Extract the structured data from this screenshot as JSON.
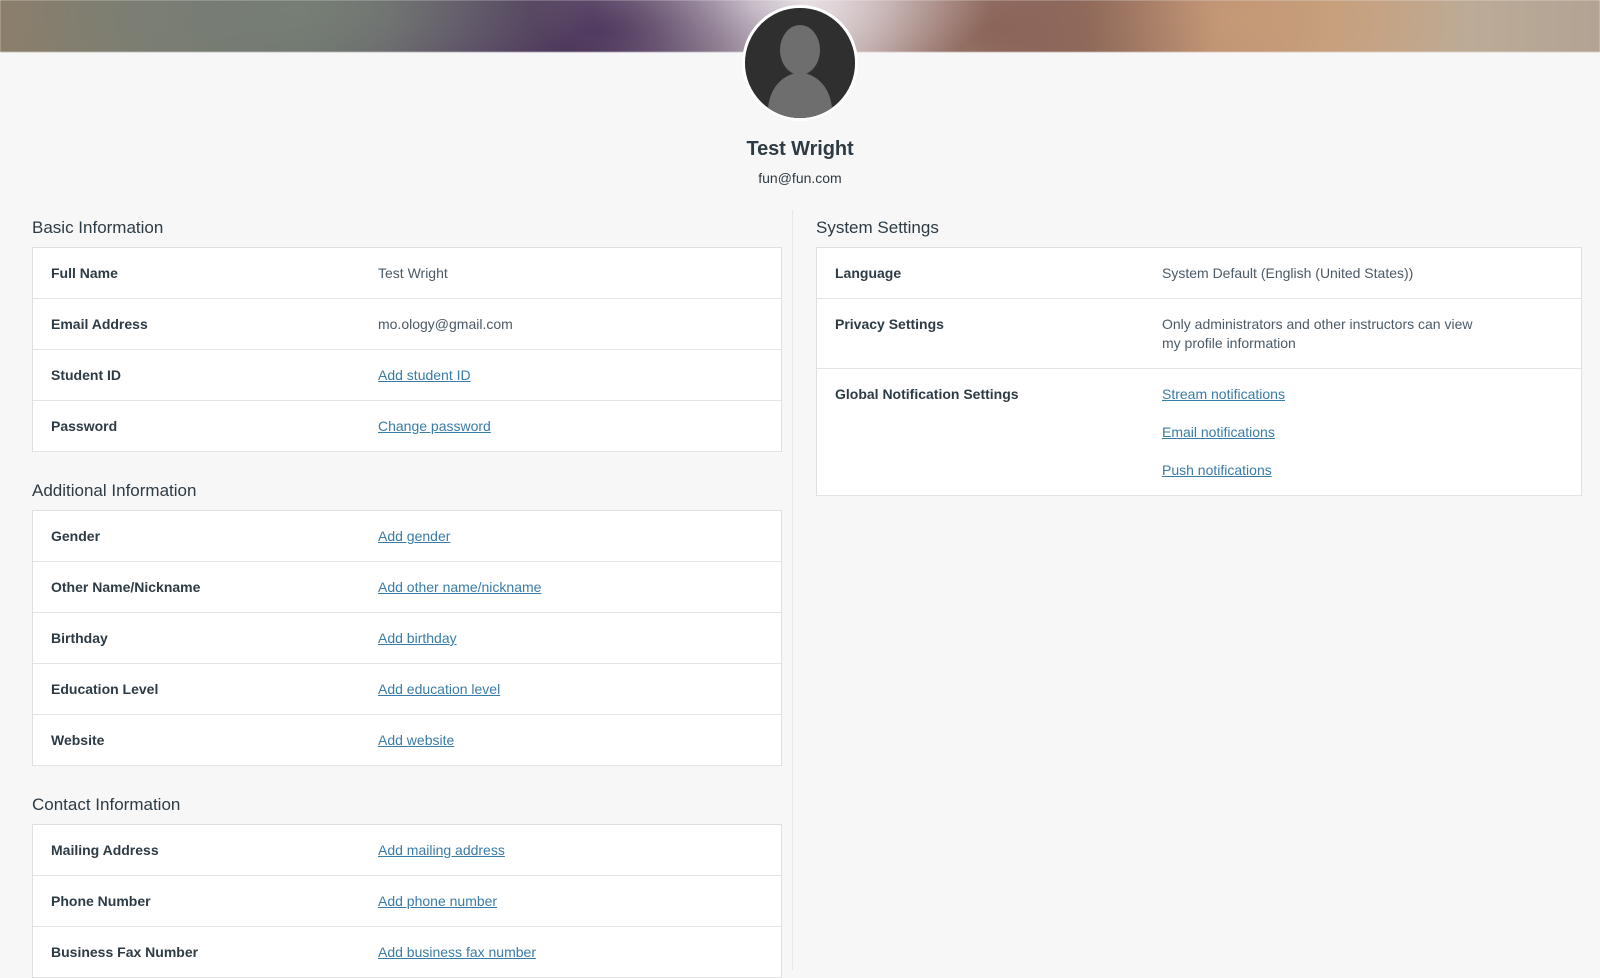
{
  "profile": {
    "name": "Test Wright",
    "email": "fun@fun.com",
    "avatar_icon": "user-silhouette-avatar"
  },
  "colors": {
    "link": "#3a7ca5",
    "text": "#2d3b45",
    "page_background": "#f7f7f7",
    "table_border": "#dfdfdf"
  },
  "left_column": {
    "sections": [
      {
        "title": "Basic Information",
        "rows": [
          {
            "label": "Full Name",
            "value": "Test Wright",
            "is_link": false
          },
          {
            "label": "Email Address",
            "value": "mo.ology@gmail.com",
            "is_link": false
          },
          {
            "label": "Student ID",
            "value": "Add student ID",
            "is_link": true
          },
          {
            "label": "Password",
            "value": "Change password",
            "is_link": true
          }
        ]
      },
      {
        "title": "Additional Information",
        "rows": [
          {
            "label": "Gender",
            "value": "Add gender",
            "is_link": true
          },
          {
            "label": "Other Name/Nickname",
            "value": "Add other name/nickname",
            "is_link": true
          },
          {
            "label": "Birthday",
            "value": "Add birthday",
            "is_link": true
          },
          {
            "label": "Education Level",
            "value": "Add education level",
            "is_link": true
          },
          {
            "label": "Website",
            "value": "Add website",
            "is_link": true
          }
        ]
      },
      {
        "title": "Contact Information",
        "rows": [
          {
            "label": "Mailing Address",
            "value": "Add mailing address",
            "is_link": true
          },
          {
            "label": "Phone Number",
            "value": "Add phone number",
            "is_link": true
          },
          {
            "label": "Business Fax Number",
            "value": "Add business fax number",
            "is_link": true
          }
        ]
      }
    ]
  },
  "right_column": {
    "sections": [
      {
        "title": "System Settings",
        "rows": [
          {
            "label": "Language",
            "value": "System Default (English (United States))",
            "is_link": false
          },
          {
            "label": "Privacy Settings",
            "value": "Only administrators and other instructors can view my profile information",
            "is_link": false
          },
          {
            "label": "Global Notification Settings",
            "links": [
              "Stream notifications",
              "Email notifications",
              "Push notifications"
            ]
          }
        ]
      }
    ]
  }
}
